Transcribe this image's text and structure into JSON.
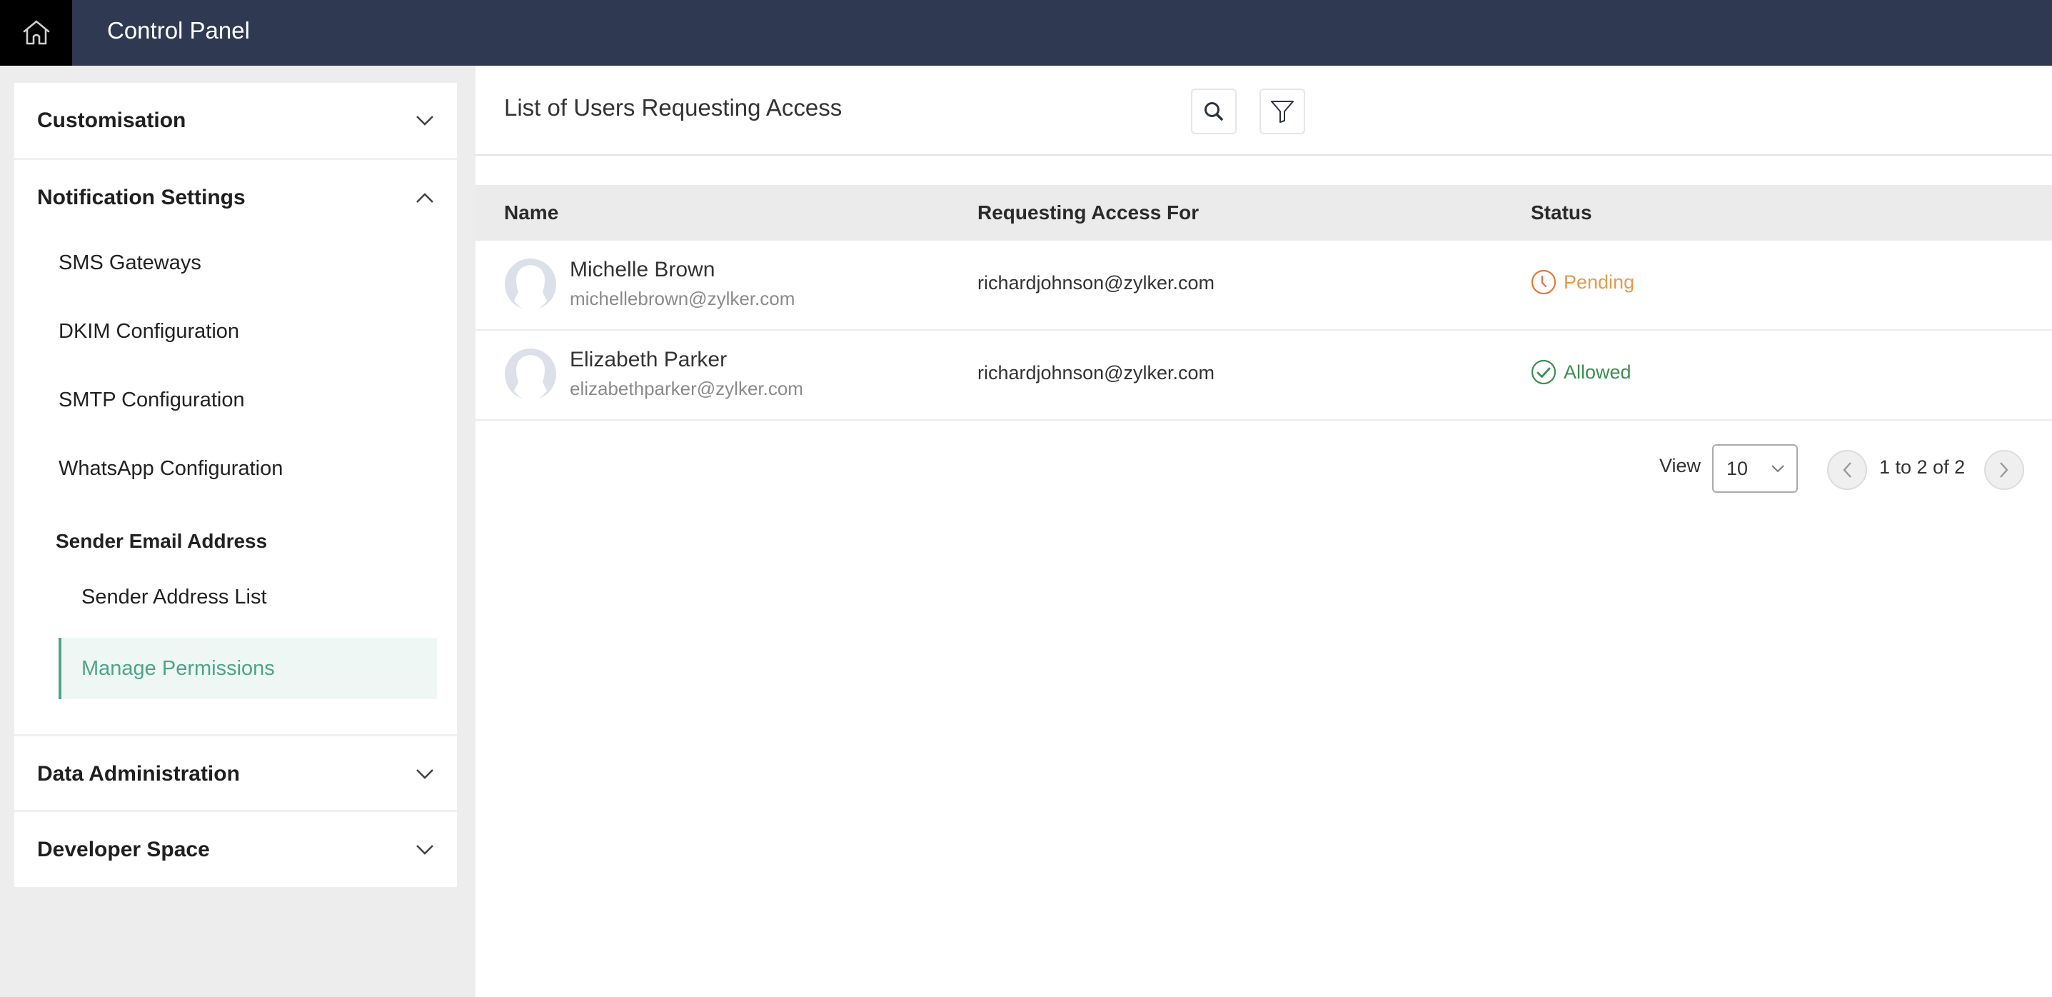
{
  "topbar": {
    "home_icon": "home-icon",
    "title": "Control Panel"
  },
  "sidebar": {
    "sections": [
      {
        "label": "Customisation",
        "expanded": false,
        "icon": "chevron-down-icon"
      },
      {
        "label": "Notification Settings",
        "expanded": true,
        "icon": "chevron-up-icon",
        "items": [
          "SMS Gateways",
          "DKIM Configuration",
          "SMTP Configuration",
          "WhatsApp Configuration"
        ],
        "group": {
          "label": "Sender Email Address",
          "items": [
            "Sender Address List",
            "Manage Permissions"
          ],
          "active": "Manage Permissions"
        }
      },
      {
        "label": "Data Administration",
        "expanded": false,
        "icon": "chevron-down-icon"
      },
      {
        "label": "Developer Space",
        "expanded": false,
        "icon": "chevron-down-icon"
      }
    ]
  },
  "main": {
    "title": "List of Users Requesting Access",
    "toolbar": {
      "search_icon": "search-icon",
      "filter_icon": "filter-icon"
    },
    "table": {
      "columns": [
        "Name",
        "Requesting Access For",
        "Status"
      ],
      "rows": [
        {
          "name": "Michelle Brown",
          "email": "michellebrown@zylker.com",
          "requesting_for": "richardjohnson@zylker.com",
          "status": "Pending",
          "status_icon": "clock-icon"
        },
        {
          "name": "Elizabeth Parker",
          "email": "elizabethparker@zylker.com",
          "requesting_for": "richardjohnson@zylker.com",
          "status": "Allowed",
          "status_icon": "check-circle-icon"
        }
      ]
    },
    "pagination": {
      "view_label": "View",
      "page_size": "10",
      "range_text": "1 to 2 of 2"
    }
  },
  "colors": {
    "topbar": "#2f3951",
    "active_accent": "#4fa388",
    "pending": "#e39a4a",
    "allowed": "#3a8f4f"
  }
}
